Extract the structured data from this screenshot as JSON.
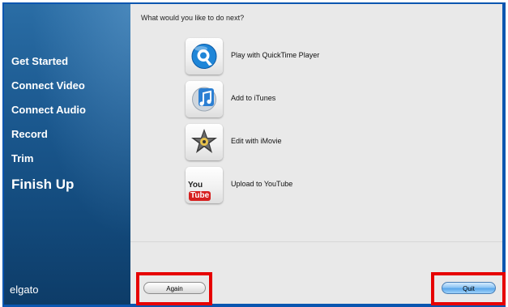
{
  "sidebar": {
    "items": [
      {
        "label": "Get Started",
        "active": false
      },
      {
        "label": "Connect Video",
        "active": false
      },
      {
        "label": "Connect Audio",
        "active": false
      },
      {
        "label": "Record",
        "active": false
      },
      {
        "label": "Trim",
        "active": false
      },
      {
        "label": "Finish Up",
        "active": true
      }
    ],
    "brand": "elgato"
  },
  "main": {
    "prompt": "What would you like to do next?",
    "options": [
      {
        "label": "Play with QuickTime Player",
        "icon": "quicktime-icon"
      },
      {
        "label": "Add to iTunes",
        "icon": "itunes-icon"
      },
      {
        "label": "Edit with iMovie",
        "icon": "imovie-icon"
      },
      {
        "label": "Upload to YouTube",
        "icon": "youtube-icon"
      }
    ],
    "youtube_logo": {
      "you": "You",
      "tube": "Tube"
    }
  },
  "footer": {
    "again_label": "Again",
    "quit_label": "Quit"
  },
  "colors": {
    "window_frame": "#0b56b0",
    "sidebar_top": "#2a6da5",
    "sidebar_bottom": "#0d3c68",
    "highlight": "#e60000",
    "quit_button": "#5aa7ea"
  }
}
